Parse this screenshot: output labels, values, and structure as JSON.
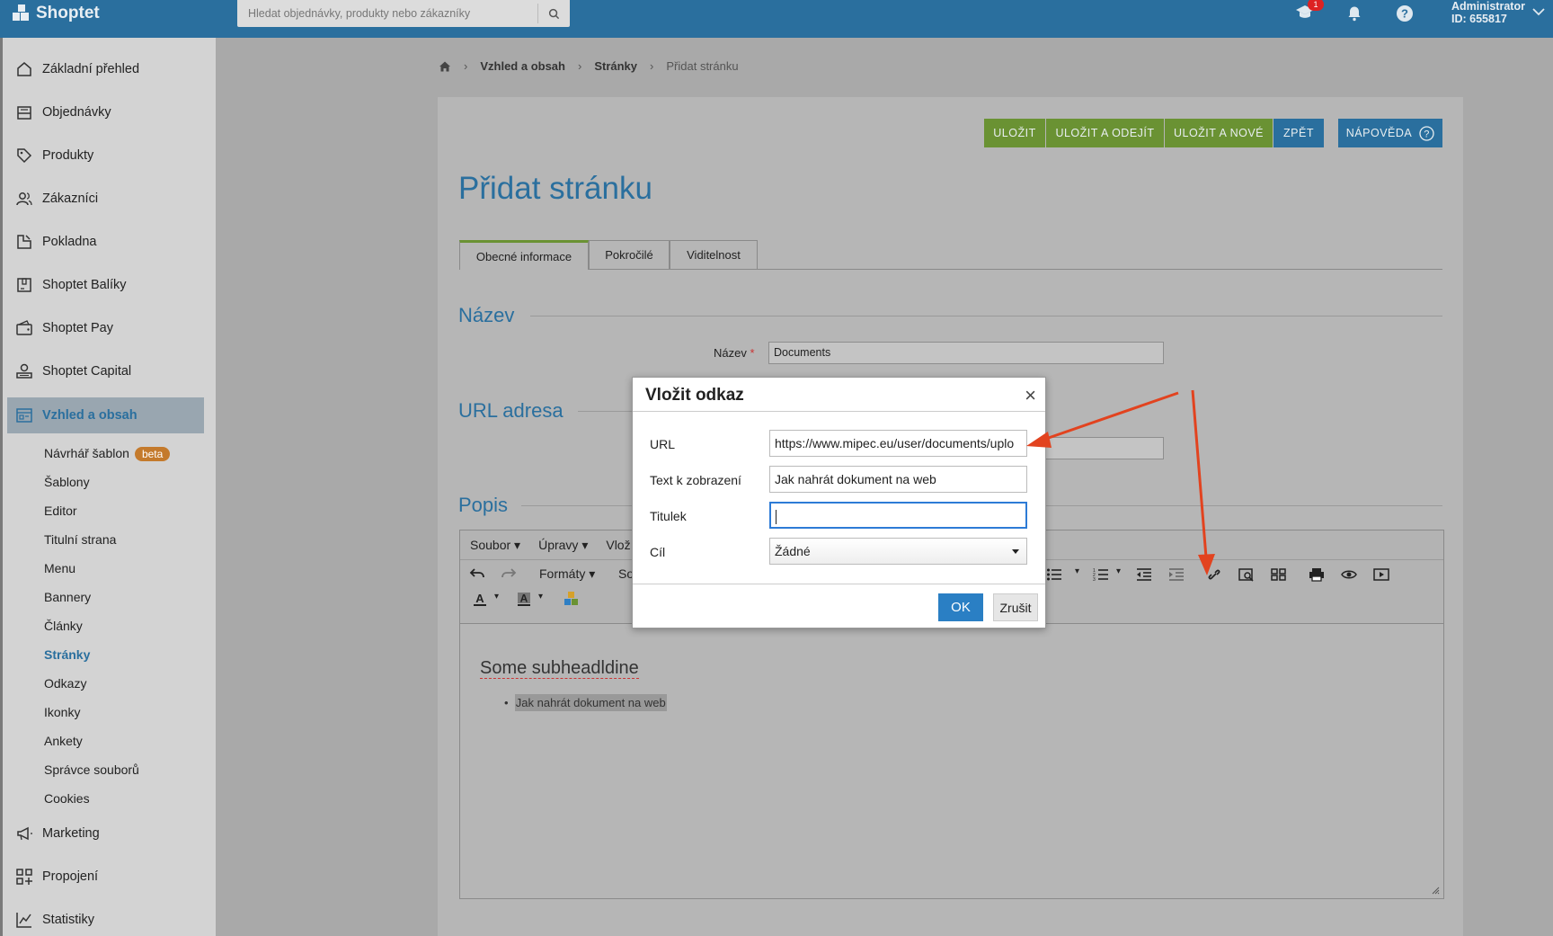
{
  "app": {
    "name": "Shoptet",
    "search_placeholder": "Hledat objednávky, produkty nebo zákazníky",
    "notification_count": "1",
    "user_name": "Administrator",
    "user_id": "ID: 655817"
  },
  "sidebar": {
    "items": [
      {
        "label": "Základní přehled",
        "icon": "home-icon"
      },
      {
        "label": "Objednávky",
        "icon": "inbox-icon"
      },
      {
        "label": "Produkty",
        "icon": "tag-icon"
      },
      {
        "label": "Zákazníci",
        "icon": "users-icon"
      },
      {
        "label": "Pokladna",
        "icon": "register-icon"
      },
      {
        "label": "Shoptet Balíky",
        "icon": "package-icon"
      },
      {
        "label": "Shoptet Pay",
        "icon": "wallet-icon"
      },
      {
        "label": "Shoptet Capital",
        "icon": "capital-icon"
      },
      {
        "label": "Vzhled a obsah",
        "icon": "layout-icon"
      },
      {
        "label": "Marketing",
        "icon": "megaphone-icon"
      },
      {
        "label": "Propojení",
        "icon": "grid-plus-icon"
      },
      {
        "label": "Statistiky",
        "icon": "chart-icon"
      }
    ],
    "subitems": [
      "Návrhář šablon",
      "Šablony",
      "Editor",
      "Titulní strana",
      "Menu",
      "Bannery",
      "Články",
      "Stránky",
      "Odkazy",
      "Ikonky",
      "Ankety",
      "Správce souborů",
      "Cookies"
    ],
    "beta_label": "beta"
  },
  "breadcrumb": {
    "level1": "Vzhled a obsah",
    "level2": "Stránky",
    "current": "Přidat stránku"
  },
  "actions": {
    "save": "ULOŽIT",
    "save_exit": "ULOŽIT A ODEJÍT",
    "save_new": "ULOŽIT A NOVÉ",
    "back": "ZPĚT",
    "help": "NÁPOVĚDA"
  },
  "page": {
    "title": "Přidat stránku",
    "tabs": [
      "Obecné informace",
      "Pokročilé",
      "Viditelnost"
    ],
    "section_name": "Název",
    "name_label": "Název",
    "name_value": "Documents",
    "section_url": "URL adresa",
    "section_desc": "Popis"
  },
  "editor": {
    "menu": [
      "Soubor",
      "Úpravy",
      "Vlož"
    ],
    "formats": "Formáty",
    "so": "So",
    "subheading": "Some subheadldine",
    "bullet": "Jak nahrát dokument na web"
  },
  "dialog": {
    "title": "Vložit odkaz",
    "url_label": "URL",
    "url_value": "https://www.mipec.eu/user/documents/uplo",
    "text_label": "Text k zobrazení",
    "text_value": "Jak nahrát dokument na web",
    "title_label": "Titulek",
    "title_value": "",
    "target_label": "Cíl",
    "target_value": "Žádné",
    "ok": "OK",
    "cancel": "Zrušit"
  },
  "colors": {
    "primary": "#2a6f9e",
    "green": "#6a9233",
    "annotation": "#e2431f"
  }
}
